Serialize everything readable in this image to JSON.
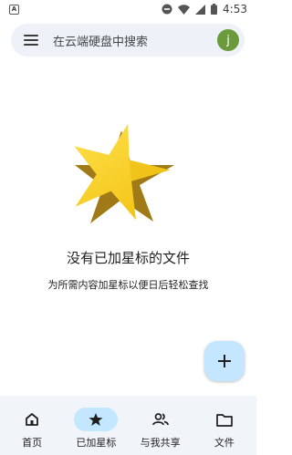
{
  "status_bar": {
    "notification_badge": "A",
    "time": "4:53",
    "icons": [
      "do-not-disturb-icon",
      "wifi-icon",
      "signal-icon",
      "battery-icon"
    ]
  },
  "search": {
    "placeholder": "在云端硬盘中搜索",
    "avatar_letter": "j",
    "avatar_color": "#6b9a3a"
  },
  "empty_state": {
    "illustration": "star-icon",
    "title": "没有已加星标的文件",
    "subtitle": "为所需内容加星标以便日后轻松查找"
  },
  "fab": {
    "icon": "plus-icon",
    "color": "#c4e7ff"
  },
  "bottom_nav": {
    "active_color": "#c2e7ff",
    "items": [
      {
        "label": "首页",
        "icon": "home-icon",
        "active": false
      },
      {
        "label": "已加星标",
        "icon": "star-icon",
        "active": true
      },
      {
        "label": "与我共享",
        "icon": "people-icon",
        "active": false
      },
      {
        "label": "文件",
        "icon": "folder-icon",
        "active": false
      }
    ]
  }
}
